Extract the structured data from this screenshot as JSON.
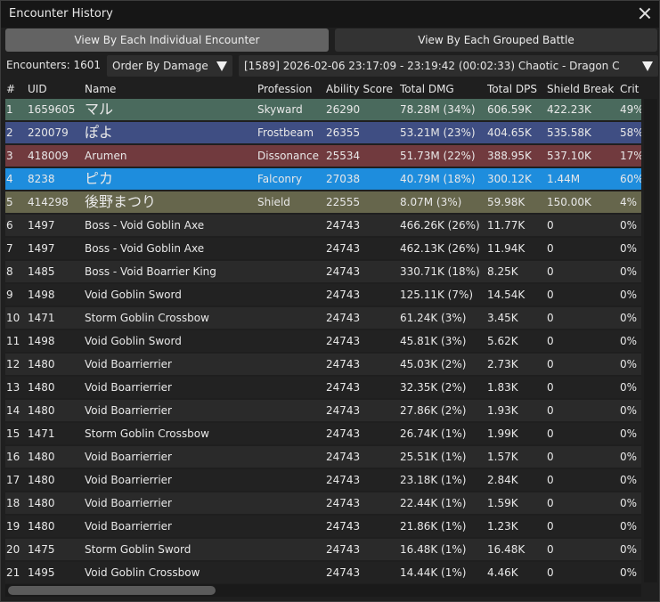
{
  "window": {
    "title": "Encounter History"
  },
  "view_buttons": {
    "individual": "View By Each Individual Encounter",
    "grouped": "View By Each Grouped Battle"
  },
  "controls": {
    "encounters_label": "Encounters: 1601",
    "order_by": "Order By Damage",
    "encounter_selected": "[1589] 2026-02-06 23:17:09 - 23:19:42 (00:02:33)  Chaotic - Dragon C"
  },
  "columns": {
    "num": "#",
    "uid": "UID",
    "name": "Name",
    "profession": "Profession",
    "ability_score": "Ability Score",
    "total_dmg": "Total DMG",
    "total_dps": "Total DPS",
    "shield_break": "Shield Break",
    "crit": "Crit"
  },
  "rows": [
    {
      "num": "1",
      "uid": "1659605",
      "name": "マル",
      "profession": "Skyward",
      "score": "26290",
      "dmg": "78.28M (34%)",
      "dps": "606.59K",
      "shield": "422.23K",
      "crit": "49%",
      "color": "#4a6a5d",
      "jp": true
    },
    {
      "num": "2",
      "uid": "220079",
      "name": "ぽよ",
      "profession": "Frostbeam",
      "score": "26355",
      "dmg": "53.21M (23%)",
      "dps": "404.65K",
      "shield": "535.58K",
      "crit": "58%",
      "color": "#3f4e83",
      "jp": true
    },
    {
      "num": "3",
      "uid": "418009",
      "name": "Arumen",
      "profession": "Dissonance",
      "score": "25534",
      "dmg": "51.73M (22%)",
      "dps": "388.95K",
      "shield": "537.10K",
      "crit": "17%",
      "color": "#713a3e",
      "jp": false
    },
    {
      "num": "4",
      "uid": "8238",
      "name": "ピカ",
      "profession": "Falconry",
      "score": "27038",
      "dmg": "40.79M (18%)",
      "dps": "300.12K",
      "shield": "1.44M",
      "crit": "60%",
      "color": "#1e8ddd",
      "jp": true
    },
    {
      "num": "5",
      "uid": "414298",
      "name": "後野まつり",
      "profession": "Shield",
      "score": "22555",
      "dmg": "8.07M (3%)",
      "dps": "59.98K",
      "shield": "150.00K",
      "crit": "4%",
      "color": "#66664c",
      "jp": true
    },
    {
      "num": "6",
      "uid": "1497",
      "name": "Boss - Void Goblin Axe",
      "profession": "",
      "score": "24743",
      "dmg": "466.26K (26%)",
      "dps": "11.77K",
      "shield": "0",
      "crit": "0%",
      "color": "#2a2a2a",
      "jp": false
    },
    {
      "num": "7",
      "uid": "1497",
      "name": "Boss - Void Goblin Axe",
      "profession": "",
      "score": "24743",
      "dmg": "462.13K (26%)",
      "dps": "11.94K",
      "shield": "0",
      "crit": "0%",
      "color": "#222222",
      "jp": false
    },
    {
      "num": "8",
      "uid": "1485",
      "name": "Boss - Void Boarrier King",
      "profession": "",
      "score": "24743",
      "dmg": "330.71K (18%)",
      "dps": "8.25K",
      "shield": "0",
      "crit": "0%",
      "color": "#2a2a2a",
      "jp": false
    },
    {
      "num": "9",
      "uid": "1498",
      "name": "Void Goblin Sword",
      "profession": "",
      "score": "24743",
      "dmg": "125.11K (7%)",
      "dps": "14.54K",
      "shield": "0",
      "crit": "0%",
      "color": "#222222",
      "jp": false
    },
    {
      "num": "10",
      "uid": "1471",
      "name": "Storm Goblin Crossbow",
      "profession": "",
      "score": "24743",
      "dmg": "61.24K (3%)",
      "dps": "3.45K",
      "shield": "0",
      "crit": "0%",
      "color": "#2a2a2a",
      "jp": false
    },
    {
      "num": "11",
      "uid": "1498",
      "name": "Void Goblin Sword",
      "profession": "",
      "score": "24743",
      "dmg": "45.81K (3%)",
      "dps": "5.62K",
      "shield": "0",
      "crit": "0%",
      "color": "#222222",
      "jp": false
    },
    {
      "num": "12",
      "uid": "1480",
      "name": "Void Boarrierrier",
      "profession": "",
      "score": "24743",
      "dmg": "45.03K (2%)",
      "dps": "2.73K",
      "shield": "0",
      "crit": "0%",
      "color": "#2a2a2a",
      "jp": false
    },
    {
      "num": "13",
      "uid": "1480",
      "name": "Void Boarrierrier",
      "profession": "",
      "score": "24743",
      "dmg": "32.35K (2%)",
      "dps": "1.83K",
      "shield": "0",
      "crit": "0%",
      "color": "#222222",
      "jp": false
    },
    {
      "num": "14",
      "uid": "1480",
      "name": "Void Boarrierrier",
      "profession": "",
      "score": "24743",
      "dmg": "27.86K (2%)",
      "dps": "1.93K",
      "shield": "0",
      "crit": "0%",
      "color": "#2a2a2a",
      "jp": false
    },
    {
      "num": "15",
      "uid": "1471",
      "name": "Storm Goblin Crossbow",
      "profession": "",
      "score": "24743",
      "dmg": "26.74K (1%)",
      "dps": "1.99K",
      "shield": "0",
      "crit": "0%",
      "color": "#222222",
      "jp": false
    },
    {
      "num": "16",
      "uid": "1480",
      "name": "Void Boarrierrier",
      "profession": "",
      "score": "24743",
      "dmg": "25.51K (1%)",
      "dps": "1.57K",
      "shield": "0",
      "crit": "0%",
      "color": "#2a2a2a",
      "jp": false
    },
    {
      "num": "17",
      "uid": "1480",
      "name": "Void Boarrierrier",
      "profession": "",
      "score": "24743",
      "dmg": "23.18K (1%)",
      "dps": "2.84K",
      "shield": "0",
      "crit": "0%",
      "color": "#222222",
      "jp": false
    },
    {
      "num": "18",
      "uid": "1480",
      "name": "Void Boarrierrier",
      "profession": "",
      "score": "24743",
      "dmg": "22.44K (1%)",
      "dps": "1.59K",
      "shield": "0",
      "crit": "0%",
      "color": "#2a2a2a",
      "jp": false
    },
    {
      "num": "19",
      "uid": "1480",
      "name": "Void Boarrierrier",
      "profession": "",
      "score": "24743",
      "dmg": "21.86K (1%)",
      "dps": "1.23K",
      "shield": "0",
      "crit": "0%",
      "color": "#222222",
      "jp": false
    },
    {
      "num": "20",
      "uid": "1475",
      "name": "Storm Goblin Sword",
      "profession": "",
      "score": "24743",
      "dmg": "16.48K (1%)",
      "dps": "16.48K",
      "shield": "0",
      "crit": "0%",
      "color": "#2a2a2a",
      "jp": false
    },
    {
      "num": "21",
      "uid": "1495",
      "name": "Void Goblin Crossbow",
      "profession": "",
      "score": "24743",
      "dmg": "14.44K (1%)",
      "dps": "4.46K",
      "shield": "0",
      "crit": "0%",
      "color": "#222222",
      "jp": false
    }
  ]
}
